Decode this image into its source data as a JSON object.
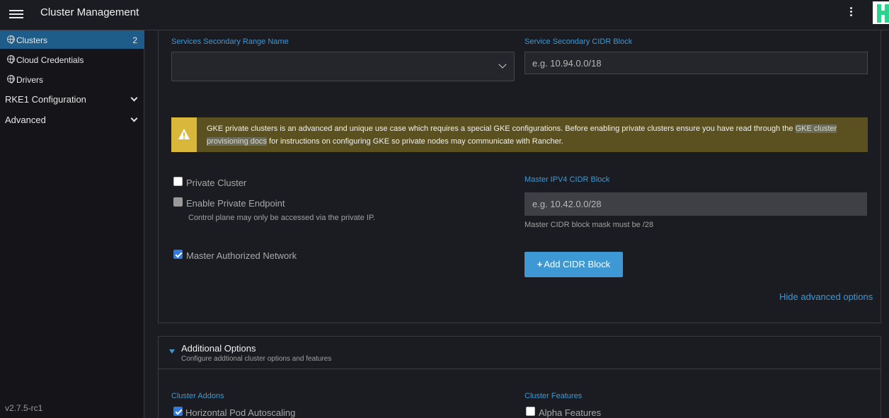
{
  "header": {
    "title": "Cluster Management"
  },
  "sidebar": {
    "items": [
      {
        "label": "Clusters",
        "count": "2"
      },
      {
        "label": "Cloud Credentials"
      },
      {
        "label": "Drivers"
      }
    ],
    "groups": [
      {
        "label": "RKE1 Configuration"
      },
      {
        "label": "Advanced"
      }
    ],
    "version": "v2.7.5-rc1"
  },
  "networking": {
    "services_range_label": "Services Secondary Range Name",
    "services_range_value": "",
    "service_cidr_label": "Service Secondary CIDR Block",
    "service_cidr_placeholder": "e.g. 10.94.0.0/18"
  },
  "banner": {
    "text_before": "GKE private clusters is an advanced and unique use case which requires a special GKE configurations. Before enabling private clusters ensure you have read through the ",
    "link_text": "GKE cluster provisioning docs",
    "text_after": " for instructions on configuring GKE so private nodes may communicate with Rancher."
  },
  "private": {
    "private_cluster_label": "Private Cluster",
    "private_endpoint_label": "Enable Private Endpoint",
    "private_endpoint_hint": "Control plane may only be accessed via the private IP.",
    "master_auth_label": "Master Authorized Network",
    "master_ipv4_label": "Master IPV4 CIDR Block",
    "master_ipv4_placeholder": "e.g. 10.42.0.0/28",
    "master_ipv4_hint": "Master CIDR block mask must be /28",
    "add_cidr_label": "Add CIDR Block",
    "hide_advanced_label": "Hide advanced options"
  },
  "additional": {
    "title": "Additional Options",
    "subtitle": "Configure addtional cluster options and features",
    "addons_label": "Cluster Addons",
    "hpa_label": "Horizontal Pod Autoscaling",
    "features_label": "Cluster Features",
    "alpha_label": "Alpha Features"
  },
  "colors": {
    "accent": "#3d98d3",
    "active_nav": "#1e5d8a",
    "warning": "#d9b73a",
    "banner_bg": "#5b5120"
  }
}
